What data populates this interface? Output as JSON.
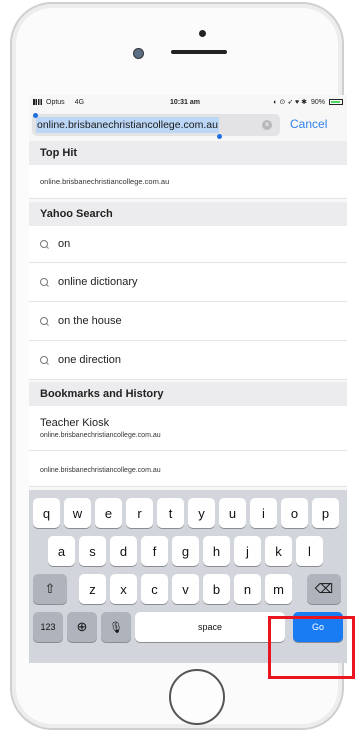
{
  "status_bar": {
    "carrier": "Optus",
    "network": "4G",
    "time": "10:31 am",
    "battery": "90%"
  },
  "url_bar": {
    "value": "online.brisbanechristiancollege.com.au",
    "cancel_label": "Cancel",
    "clear_glyph": "×"
  },
  "top_hit": {
    "header": "Top Hit",
    "url": "online.brisbanechristiancollege.com.au"
  },
  "yahoo": {
    "header": "Yahoo Search",
    "suggestions": [
      "on",
      "online dictionary",
      "on the house",
      "one direction"
    ]
  },
  "bookmarks": {
    "header": "Bookmarks and History",
    "items": [
      {
        "title": "Teacher Kiosk",
        "url": "online.brisbanechristiancollege.com.au"
      },
      {
        "title": "",
        "url": "online.brisbanechristiancollege.com.au"
      }
    ]
  },
  "keyboard": {
    "row1": [
      "q",
      "w",
      "e",
      "r",
      "t",
      "y",
      "u",
      "i",
      "o",
      "p"
    ],
    "row2": [
      "a",
      "s",
      "d",
      "f",
      "g",
      "h",
      "j",
      "k",
      "l"
    ],
    "row3": [
      "z",
      "x",
      "c",
      "v",
      "b",
      "n",
      "m"
    ],
    "shift_glyph": "⇧",
    "backspace_glyph": "⌫",
    "numbers_label": "123",
    "globe_glyph": "⊕",
    "mic_glyph": "🎙",
    "space_label": "space",
    "go_label": "Go"
  },
  "colors": {
    "accent": "#1a7cf3",
    "highlight": "#e8141f"
  }
}
